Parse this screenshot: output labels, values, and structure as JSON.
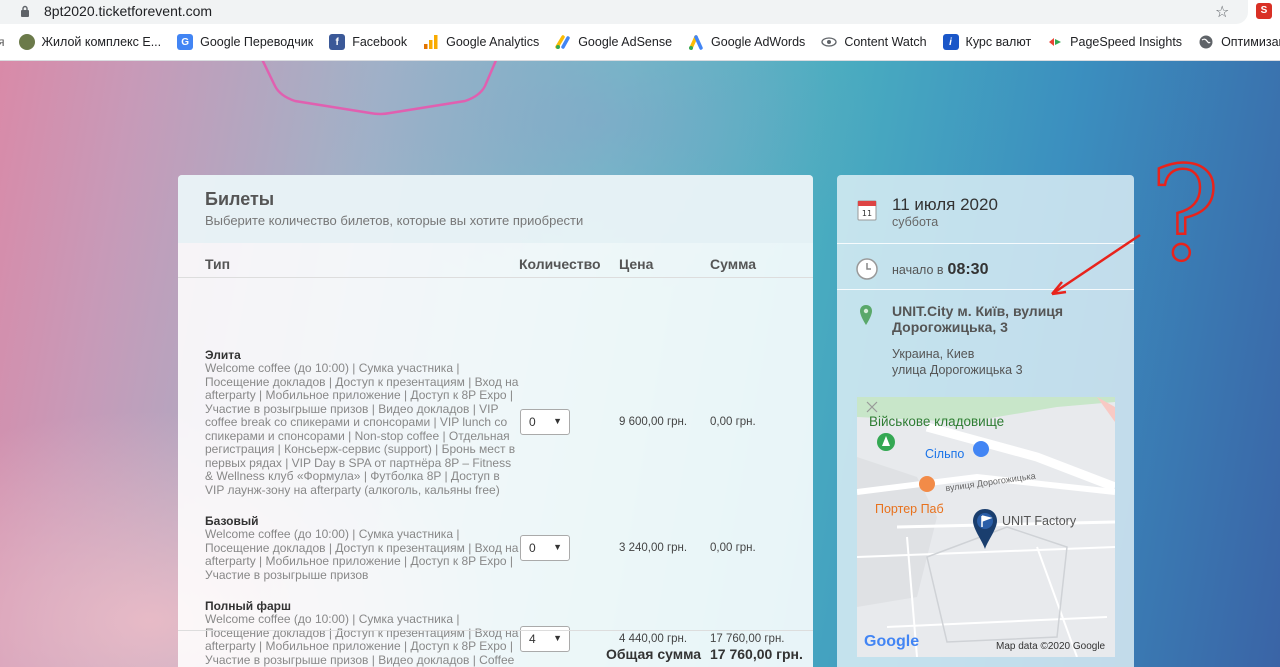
{
  "browser": {
    "url": "8pt2020.ticketforevent.com",
    "bookmarks": [
      {
        "label": "Жилой комплекс E...",
        "icon": "residence-icon",
        "color": "#556b2f"
      },
      {
        "label": "Google Переводчик",
        "icon": "google-translate-icon",
        "color": "#4285f4"
      },
      {
        "label": "Facebook",
        "icon": "facebook-icon",
        "color": "#3b5998"
      },
      {
        "label": "Google Analytics",
        "icon": "google-analytics-icon",
        "color": "#f9ab00"
      },
      {
        "label": "Google AdSense",
        "icon": "google-adsense-icon",
        "color": "#fbbc04"
      },
      {
        "label": "Google AdWords",
        "icon": "google-adwords-icon",
        "color": "#4285f4"
      },
      {
        "label": "Content Watch",
        "icon": "eye-icon",
        "color": "#5f6368"
      },
      {
        "label": "Курс валют",
        "icon": "info-icon",
        "color": "#1a73e8"
      },
      {
        "label": "PageSpeed Insights",
        "icon": "pagespeed-icon",
        "color": "#34a853"
      },
      {
        "label": "Оптимизаци д",
        "icon": "globe-icon",
        "color": "#5f6368"
      }
    ],
    "extension_label": "S"
  },
  "tickets": {
    "title": "Билеты",
    "subtitle": "Выберите количество билетов, которые вы хотите приобрести",
    "columns": {
      "type": "Тип",
      "quantity": "Количество",
      "price": "Цена",
      "sum": "Сумма"
    },
    "rows": [
      {
        "name": "Элита",
        "description": "Welcome coffee (до 10:00) | Сумка участника | Посещение докладов | Доступ к презентациям | Вход на afterparty | Мобильное приложение | Доступ к 8P Expo | Участие в розыгрыше призов | Видео докладов | VIP coffee break со спикерами и спонсорами | VIP lunch со спикерами и спонсорами | Non-stop coffee | Отдельная регистрация | Консьерж-сервис (support) | Бронь мест в первых рядах | VIP Day в SPA от партнёра 8P – Fitness & Wellness клуб «Формула» | Футболка 8P | Доступ в VIP лаунж-зону на afterparty (алкоголь, кальяны free)",
        "quantity": "0",
        "price": "9 600,00 грн.",
        "sum": "0,00 грн."
      },
      {
        "name": "Базовый",
        "description": "Welcome coffee (до 10:00) | Сумка участника | Посещение докладов | Доступ к презентациям | Вход на afterparty | Мобильное приложение | Доступ к 8P Expo | Участие в розыгрыше призов",
        "quantity": "0",
        "price": "3 240,00 грн.",
        "sum": "0,00 грн."
      },
      {
        "name": "Полный фарш",
        "description": "Welcome coffee (до 10:00) | Сумка участника | Посещение докладов | Доступ к презентациям | Вход на afterparty | Мобильное приложение | Доступ к 8P Expo | Участие в розыгрыше призов | Видео докладов | Coffee break | Lunch (шведский стол) | Non-stop coffee",
        "quantity": "4",
        "price": "4 440,00 грн.",
        "sum": "17 760,00 грн."
      }
    ],
    "total_label": "Общая сумма",
    "total_value": "17 760,00 грн."
  },
  "event": {
    "calendar_day": "11",
    "date": "11 июля 2020",
    "weekday": "суббота",
    "time_label": "начало в",
    "time": "08:30",
    "venue_name": "UNIT.City м. Київ, вулиця Дорогожицька, 3",
    "country_city": "Украина, Киев",
    "street": "улица Дорогожицька 3"
  },
  "map": {
    "labels": {
      "cemetery": "Військове кладовище",
      "silpo": "Сільпо",
      "street": "вулиця Дорогожицька",
      "pub": "Портер Паб",
      "factory": "UNIT Factory"
    },
    "logo": "Google",
    "attribution": "Map data ©2020 Google"
  },
  "annotation": {
    "mark": "?",
    "color": "#e8231c"
  }
}
